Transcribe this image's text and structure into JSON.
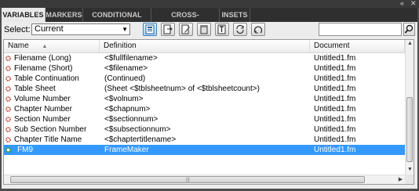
{
  "window": {
    "collapse_label": "«",
    "close_label": "✕"
  },
  "tabs": [
    {
      "label": "VARIABLES",
      "active": true
    },
    {
      "label": "MARKERS",
      "active": false
    },
    {
      "label": "CONDITIONAL TEXT",
      "active": false
    },
    {
      "label": "CROSS-REFERENCES",
      "active": false
    },
    {
      "label": "INSETS",
      "active": false
    }
  ],
  "toolbar": {
    "select_label": "Select:",
    "select_value": "Current",
    "buttons": [
      "show-document-variables-icon",
      "import-variables-icon",
      "edit-variable-icon",
      "delete-variable-icon",
      "insert-variable-icon",
      "update-variables-icon",
      "convert-to-text-icon"
    ],
    "search_value": ""
  },
  "table": {
    "columns": {
      "name": "Name",
      "sort_indicator": "▲",
      "definition": "Definition",
      "document": "Document"
    },
    "rows": [
      {
        "name": "Filename (Long)",
        "definition": "<$fullfilename>",
        "document": "Untitled1.fm",
        "selected": false
      },
      {
        "name": "Filename (Short)",
        "definition": "<$filename>",
        "document": "Untitled1.fm",
        "selected": false
      },
      {
        "name": "Table Continuation",
        "definition": "(Continued)",
        "document": "Untitled1.fm",
        "selected": false
      },
      {
        "name": "Table Sheet",
        "definition": "(Sheet <$tblsheetnum> of <$tblsheetcount>)",
        "document": "Untitled1.fm",
        "selected": false
      },
      {
        "name": "Volume Number",
        "definition": "<$volnum>",
        "document": "Untitled1.fm",
        "selected": false
      },
      {
        "name": "Chapter Number",
        "definition": "<$chapnum>",
        "document": "Untitled1.fm",
        "selected": false
      },
      {
        "name": "Section Number",
        "definition": "<$sectionnum>",
        "document": "Untitled1.fm",
        "selected": false
      },
      {
        "name": "Sub Section Number",
        "definition": "<$subsectionnum>",
        "document": "Untitled1.fm",
        "selected": false
      },
      {
        "name": "Chapter Title Name",
        "definition": "<$chaptertitlename>",
        "document": "Untitled1.fm",
        "selected": false
      },
      {
        "name": "FM9",
        "definition": "FrameMaker",
        "document": "Untitled1.fm",
        "selected": true
      }
    ]
  },
  "colors": {
    "selection": "#3399ff",
    "system_variable_icon": "#c0392b",
    "user_variable_icon": "#3a9a3a"
  }
}
